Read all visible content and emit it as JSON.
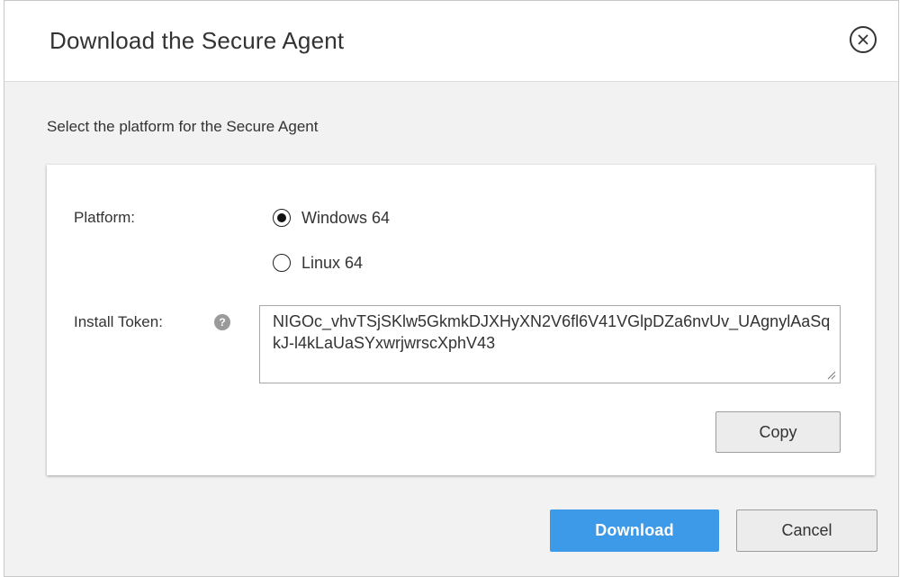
{
  "dialog": {
    "title": "Download the Secure Agent",
    "subtitle": "Select the platform for the Secure Agent"
  },
  "form": {
    "platform_label": "Platform:",
    "platforms": [
      {
        "label": "Windows 64",
        "selected": true
      },
      {
        "label": "Linux 64",
        "selected": false
      }
    ],
    "token_label": "Install Token:",
    "help_glyph": "?",
    "token_value": "NIGOc_vhvTSjSKlw5GkmkDJXHyXN2V6fl6V41VGlpDZa6nvUv_UAgnylAaSqkJ-l4kLaUaSYxwrjwrscXphV43",
    "copy_label": "Copy"
  },
  "footer": {
    "download_label": "Download",
    "cancel_label": "Cancel"
  },
  "colors": {
    "primary": "#3d9ae8",
    "dialog_bg": "#f2f2f2"
  },
  "icons": {
    "close": "close-circle-icon",
    "help": "help-icon",
    "resize": "resize-handle-icon"
  }
}
